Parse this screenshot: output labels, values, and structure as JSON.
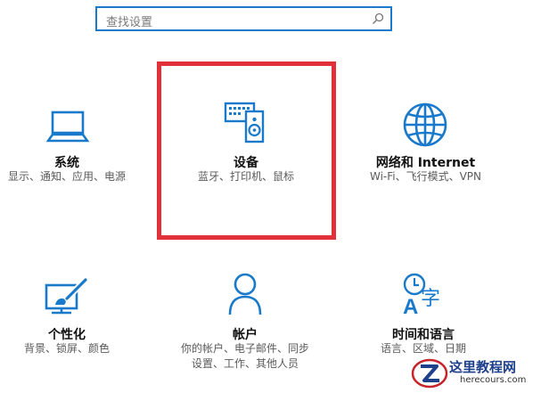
{
  "search": {
    "placeholder": "查找设置"
  },
  "tiles": [
    {
      "title": "系统",
      "desc": "显示、通知、应用、电源"
    },
    {
      "title": "设备",
      "desc": "蓝牙、打印机、鼠标"
    },
    {
      "title": "网络和 Internet",
      "desc": "Wi-Fi、飞行模式、VPN"
    },
    {
      "title": "个性化",
      "desc": "背景、锁屏、颜色"
    },
    {
      "title": "帐户",
      "desc_line1": "你的帐户、电子邮件、同步",
      "desc_line2": "设置、工作、其他人员"
    },
    {
      "title": "时间和语言",
      "desc": "语言、区域、日期"
    }
  ],
  "watermark": {
    "title": "这里教程网",
    "url": "herecours.com"
  },
  "colors": {
    "accent": "#1979ca",
    "highlight": "#e0313a"
  }
}
